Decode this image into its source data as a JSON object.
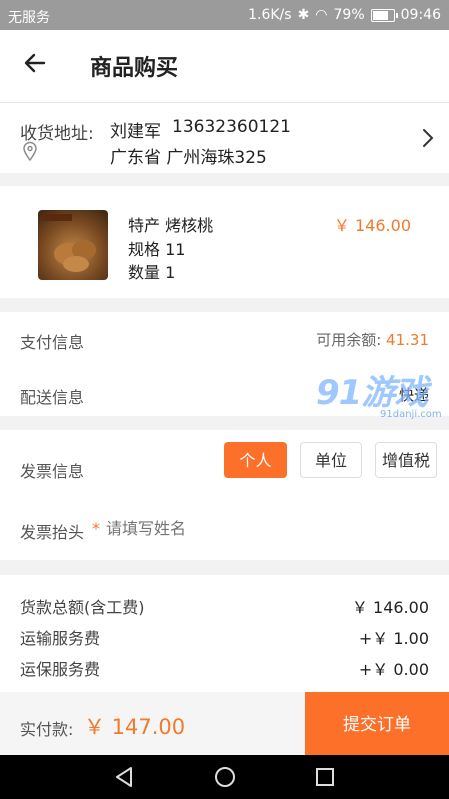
{
  "status_bar": {
    "carrier": "无服务",
    "speed": "1.6K/s",
    "battery": "79%",
    "time": "09:46",
    "battery_level": 0.79
  },
  "header": {
    "title": "商品购买"
  },
  "address": {
    "label": "收货地址:",
    "name": "刘建军",
    "phone": "13632360121",
    "line": "广东省 广州海珠325"
  },
  "product": {
    "name": "特产 烤核桃",
    "spec": "规格 11",
    "qty": "数量 1",
    "price": "￥ 146.00"
  },
  "payment": {
    "label": "支付信息",
    "balance_label": "可用余额:",
    "balance": "41.31"
  },
  "delivery": {
    "label": "配送信息",
    "value": "快递"
  },
  "invoice": {
    "label": "发票信息",
    "options": [
      "个人",
      "单位",
      "增值税"
    ],
    "selected": "个人",
    "title_label": "发票抬头",
    "required_mark": "*",
    "title_placeholder": "请填写姓名"
  },
  "summary": [
    {
      "label": "货款总额(含工费)",
      "value": "￥ 146.00"
    },
    {
      "label": "运输服务费",
      "value": "+￥ 1.00"
    },
    {
      "label": "运保服务费",
      "value": "+￥ 0.00"
    }
  ],
  "footer": {
    "pay_label": "实付款:",
    "pay_total": "￥ 147.00",
    "submit_label": "提交订单"
  },
  "watermark": {
    "text": "91游戏",
    "url": "91danji.com"
  },
  "colors": {
    "accent": "#fc7029",
    "price": "#f27a2c"
  }
}
